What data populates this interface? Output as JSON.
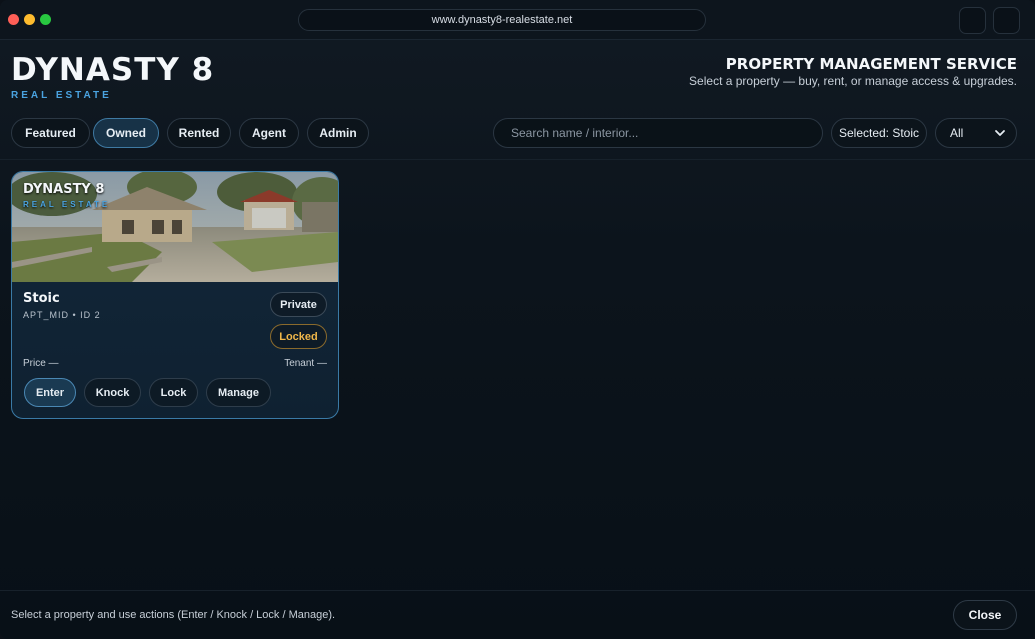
{
  "browser": {
    "url": "www.dynasty8-realestate.net"
  },
  "header": {
    "brand": "DYNASTY 8",
    "brand_sub": "REAL ESTATE",
    "service_title": "PROPERTY MANAGEMENT SERVICE",
    "service_subtitle": "Select a property — buy, rent, or manage access & upgrades."
  },
  "toolbar": {
    "tabs": [
      {
        "label": "Featured",
        "active": false
      },
      {
        "label": "Owned",
        "active": true
      },
      {
        "label": "Rented",
        "active": false
      },
      {
        "label": "Agent",
        "active": false
      },
      {
        "label": "Admin",
        "active": false
      }
    ],
    "search_placeholder": "Search name / interior...",
    "selected_label": "Selected: Stoic",
    "filter_value": "All"
  },
  "property": {
    "image_brand": "DYNASTY 8",
    "image_brand_sub": "REAL ESTATE",
    "name": "Stoic",
    "meta": "APT_MID • ID 2",
    "badge_visibility": "Private",
    "badge_lock": "Locked",
    "price": "Price —",
    "tenant": "Tenant —",
    "actions": [
      "Enter",
      "Knock",
      "Lock",
      "Manage"
    ]
  },
  "footer": {
    "hint": "Select a property and use actions (Enter / Knock / Lock / Manage).",
    "close_label": "Close"
  },
  "colors": {
    "accent": "#4aa3e0",
    "locked": "#f0b74a"
  }
}
